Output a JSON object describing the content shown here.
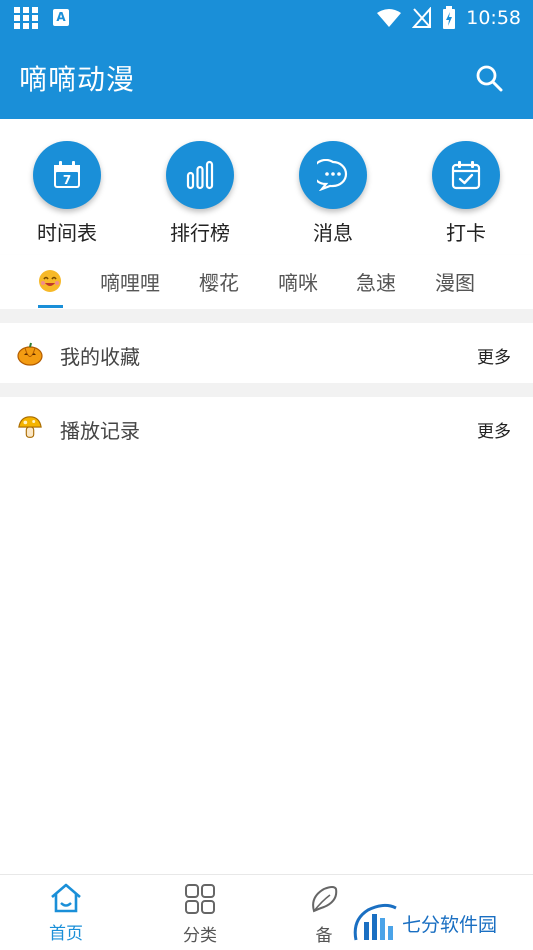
{
  "status_bar": {
    "time": "10:58",
    "app_badge": "A"
  },
  "app_bar": {
    "title": "嘀嘀动漫"
  },
  "quick_actions": [
    {
      "label": "时间表",
      "icon": "calendar-icon",
      "day": "7"
    },
    {
      "label": "排行榜",
      "icon": "bar-chart-icon"
    },
    {
      "label": "消息",
      "icon": "chat-bubble-icon"
    },
    {
      "label": "打卡",
      "icon": "calendar-check-icon"
    }
  ],
  "tabs": {
    "active_icon": "smiley-icon",
    "items": [
      "嘀哩哩",
      "樱花",
      "嘀咪",
      "急速",
      "漫图"
    ]
  },
  "sections": [
    {
      "title": "我的收藏",
      "more": "更多",
      "icon": "pumpkin-icon"
    },
    {
      "title": "播放记录",
      "more": "更多",
      "icon": "mushroom-icon"
    }
  ],
  "bottom_nav": [
    {
      "label": "首页",
      "icon": "home-icon",
      "active": true
    },
    {
      "label": "分类",
      "icon": "grid-icon",
      "active": false
    },
    {
      "label": "备",
      "icon": "leaf-icon",
      "active": false
    }
  ],
  "watermark": {
    "text": "七分软件园"
  },
  "colors": {
    "primary": "#1a8fd8",
    "background": "#ffffff",
    "divider": "#f2f2f2"
  }
}
